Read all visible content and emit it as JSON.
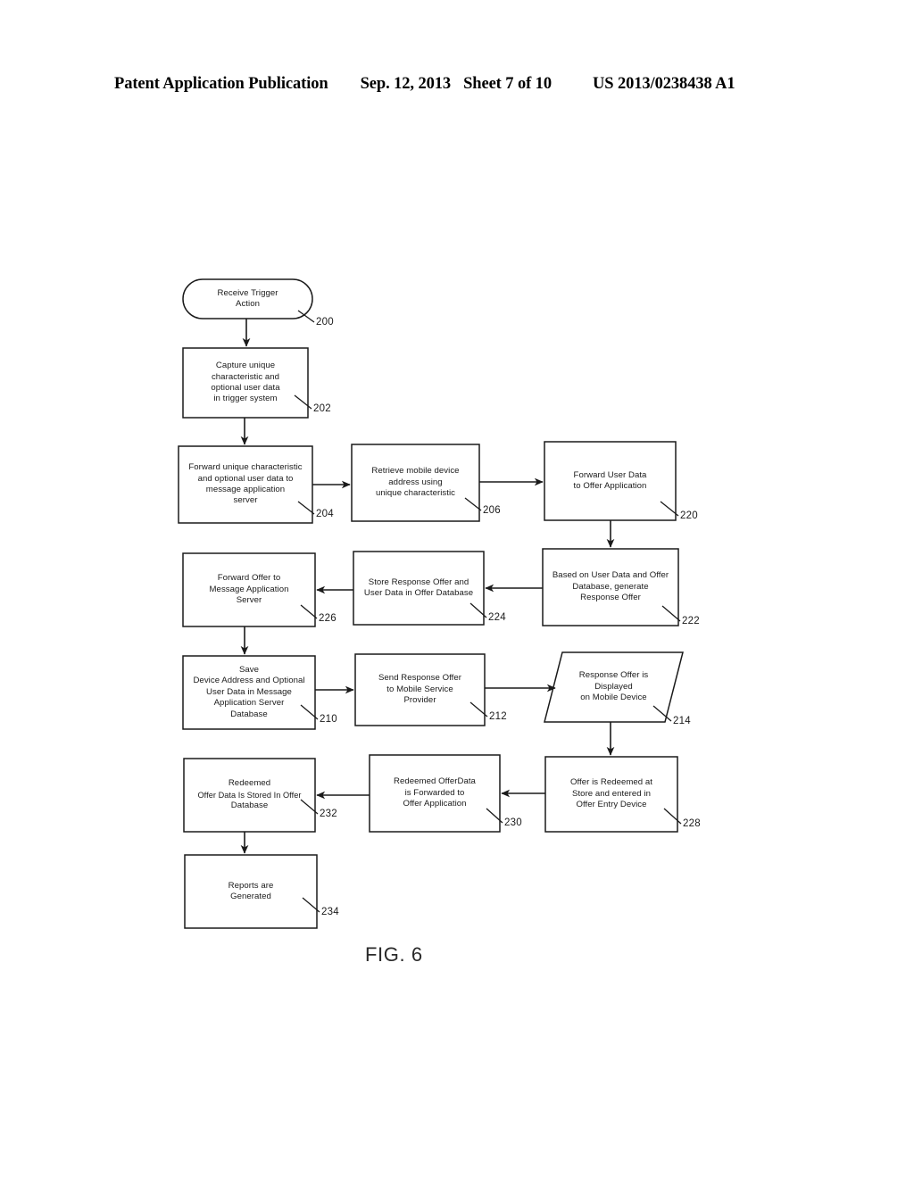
{
  "header": {
    "publication": "Patent Application Publication",
    "date": "Sep. 12, 2013",
    "sheet": "Sheet 7 of 10",
    "patent_number": "US 2013/0238438 A1"
  },
  "figure": {
    "caption": "FIG. 6",
    "nodes": [
      {
        "ref": "200",
        "shape": "terminator",
        "lines": [
          "Receive Trigger",
          "Action"
        ]
      },
      {
        "ref": "202",
        "shape": "process",
        "lines": [
          "Capture unique",
          "characteristic  and",
          "optional  user data",
          "in trigger system"
        ]
      },
      {
        "ref": "204",
        "shape": "process",
        "lines": [
          "Forward unique characteristic",
          "and optional user data to",
          "message application",
          "server"
        ]
      },
      {
        "ref": "206",
        "shape": "process",
        "lines": [
          "Retrieve mobile device",
          "address using",
          "unique characteristic"
        ]
      },
      {
        "ref": "220",
        "shape": "process",
        "lines": [
          "Forward User Data",
          "to Offer Application"
        ]
      },
      {
        "ref": "222",
        "shape": "process",
        "lines": [
          "Based on User Data and Offer",
          "Database, generate",
          "Response  Offer"
        ]
      },
      {
        "ref": "224",
        "shape": "process",
        "lines": [
          "Store Response Offer and",
          "User Data in Offer Database"
        ]
      },
      {
        "ref": "226",
        "shape": "process",
        "lines": [
          "Forward Offer to",
          "Message Application",
          "Server"
        ]
      },
      {
        "ref": "210",
        "shape": "process",
        "lines": [
          "Save",
          "Device Address and Optional",
          "User Data in Message",
          "Application Server",
          "Database"
        ]
      },
      {
        "ref": "212",
        "shape": "process",
        "lines": [
          "Send Response Offer",
          "to Mobile Service",
          "Provider"
        ]
      },
      {
        "ref": "214",
        "shape": "parallelogram",
        "lines": [
          "Response Offer is",
          "Displayed",
          "on Mobile Device"
        ]
      },
      {
        "ref": "228",
        "shape": "process",
        "lines": [
          "Offer is Redeemed at",
          "Store and entered in",
          "Offer Entry Device"
        ]
      },
      {
        "ref": "230",
        "shape": "process",
        "lines": [
          "Redeemed OfferData",
          "is Forwarded to",
          "Offer Application"
        ]
      },
      {
        "ref": "232",
        "shape": "process",
        "lines": [
          "Redeemed",
          "Offer Data  Is Stored In Offer",
          "Database"
        ]
      },
      {
        "ref": "234",
        "shape": "process",
        "lines": [
          "Reports are",
          "Generated"
        ]
      }
    ]
  }
}
